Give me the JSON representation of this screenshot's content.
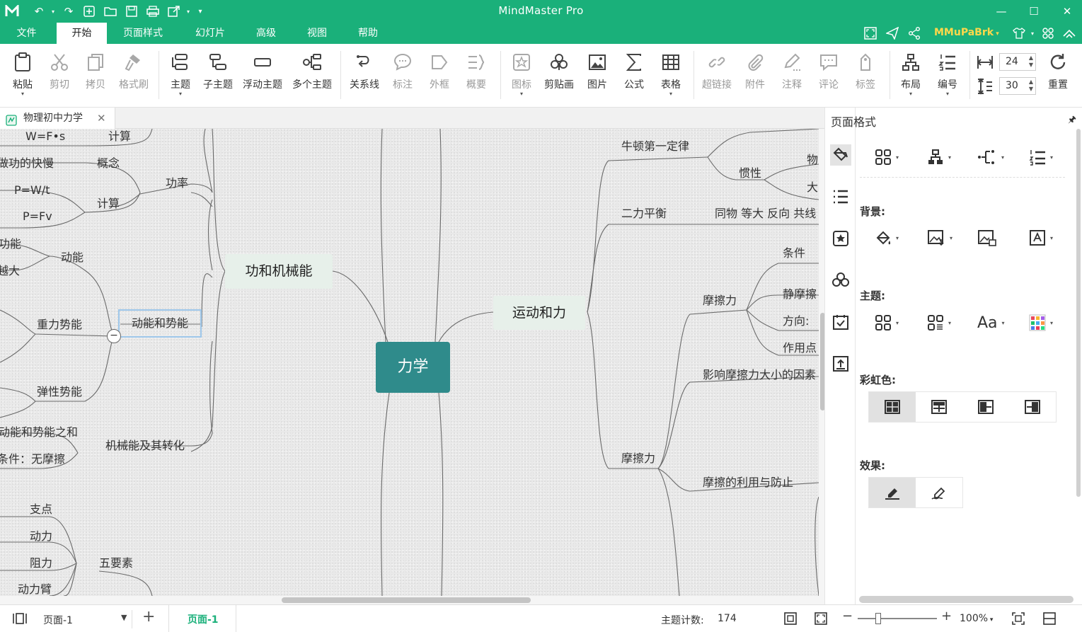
{
  "app": {
    "title": "MindMaster Pro"
  },
  "menu": {
    "items": [
      "文件",
      "开始",
      "页面样式",
      "幻灯片",
      "高级",
      "视图",
      "帮助"
    ],
    "active_index": 1,
    "user": "MMuPaBrk"
  },
  "ribbon": {
    "buttons": [
      {
        "label": "粘贴",
        "icon": "clipboard-icon",
        "enabled": true
      },
      {
        "label": "剪切",
        "icon": "scissors-icon",
        "enabled": false
      },
      {
        "label": "拷贝",
        "icon": "copy-icon",
        "enabled": false
      },
      {
        "label": "格式刷",
        "icon": "format-brush-icon",
        "enabled": false
      },
      {
        "label": "主题",
        "icon": "topic-icon",
        "enabled": true
      },
      {
        "label": "子主题",
        "icon": "subtopic-icon",
        "enabled": true
      },
      {
        "label": "浮动主题",
        "icon": "floating-topic-icon",
        "enabled": true
      },
      {
        "label": "多个主题",
        "icon": "multiple-topics-icon",
        "enabled": true
      },
      {
        "label": "关系线",
        "icon": "relationship-icon",
        "enabled": true
      },
      {
        "label": "标注",
        "icon": "callout-icon",
        "enabled": false
      },
      {
        "label": "外框",
        "icon": "boundary-icon",
        "enabled": false
      },
      {
        "label": "概要",
        "icon": "summary-icon",
        "enabled": false
      },
      {
        "label": "图标",
        "icon": "mark-icon",
        "enabled": false
      },
      {
        "label": "剪贴画",
        "icon": "clipart-icon",
        "enabled": true
      },
      {
        "label": "图片",
        "icon": "picture-icon",
        "enabled": true
      },
      {
        "label": "公式",
        "icon": "formula-icon",
        "enabled": true
      },
      {
        "label": "表格",
        "icon": "table-icon",
        "enabled": true
      },
      {
        "label": "超链接",
        "icon": "hyperlink-icon",
        "enabled": false
      },
      {
        "label": "附件",
        "icon": "attachment-icon",
        "enabled": false
      },
      {
        "label": "注释",
        "icon": "note-icon",
        "enabled": false
      },
      {
        "label": "评论",
        "icon": "comment-icon",
        "enabled": false
      },
      {
        "label": "标签",
        "icon": "tag-icon",
        "enabled": false
      },
      {
        "label": "布局",
        "icon": "layout-icon",
        "enabled": true
      },
      {
        "label": "编号",
        "icon": "numbering-icon",
        "enabled": true
      },
      {
        "label": "重置",
        "icon": "reset-icon",
        "enabled": true
      }
    ],
    "spacing_h": "24",
    "spacing_v": "30"
  },
  "document": {
    "tab_title": "物理初中力学"
  },
  "mindmap": {
    "root": "力学",
    "main_topics": [
      "功和机械能",
      "运动和力"
    ],
    "selected": "动能和势能",
    "texts": [
      "W=F•s",
      "计算",
      "做功的快慢",
      "概念",
      "功率",
      "P=W/t",
      "计算",
      "P=Fv",
      "功能",
      "动能",
      "越大",
      "重力势能",
      "弹性势能",
      "动能和势能之和",
      "机械能及其转化",
      "条件：无摩擦",
      "支点",
      "动力",
      "阻力",
      "五要素",
      "动力臂",
      "牛顿第一定律",
      "物",
      "惯性",
      "大",
      "二力平衡",
      "同物 等大 反向 共线",
      "条件",
      "静摩擦",
      "摩擦力",
      "方向:",
      "作用点",
      "影响摩擦力大小的因素",
      "摩擦力",
      "摩擦的利用与防止"
    ]
  },
  "panel": {
    "title": "页面格式",
    "sections": {
      "background": "背景:",
      "theme": "主题:",
      "rainbow": "彩虹色:",
      "effect": "效果:"
    },
    "side_icons": [
      "page-format-icon",
      "outline-icon",
      "mark-icon",
      "clipart-icon",
      "task-icon",
      "export-icon"
    ]
  },
  "status": {
    "page_select": "页面-1",
    "page_tab": "页面-1",
    "topic_count_label": "主题计数:",
    "topic_count": "174",
    "zoom": "100%"
  },
  "colors": {
    "brand": "#1ab07a",
    "root": "#2f8b8b",
    "main_topic_bg": "#e7f0ea",
    "username": "#ffd84a"
  }
}
